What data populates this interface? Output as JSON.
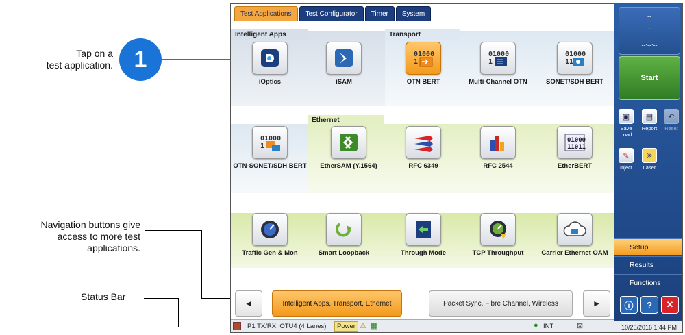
{
  "callouts": {
    "step_number": "1",
    "tap_line1": "Tap on a",
    "tap_line2": "test application.",
    "nav_line1": "Navigation buttons give",
    "nav_line2": "access to more test",
    "nav_line3": "applications.",
    "status_bar": "Status Bar"
  },
  "tabs": [
    "Test Applications",
    "Test Configurator",
    "Timer",
    "System"
  ],
  "groups": {
    "intelligent": "Intelligent Apps",
    "transport": "Transport",
    "ethernet": "Ethernet"
  },
  "apps": [
    {
      "label": "iOptics",
      "icon": "ioptics-icon"
    },
    {
      "label": "iSAM",
      "icon": "isam-icon"
    },
    {
      "label": "OTN BERT",
      "icon": "otn-bert-icon"
    },
    {
      "label": "Multi-Channel OTN",
      "icon": "multi-channel-otn-icon"
    },
    {
      "label": "SONET/SDH BERT",
      "icon": "sonet-sdh-bert-icon"
    },
    {
      "label": "OTN-SONET/SDH BERT",
      "icon": "otn-sonet-sdh-bert-icon"
    },
    {
      "label": "EtherSAM (Y.1564)",
      "icon": "ethersam-icon"
    },
    {
      "label": "RFC 6349",
      "icon": "rfc6349-icon"
    },
    {
      "label": "RFC 2544",
      "icon": "rfc2544-icon"
    },
    {
      "label": "EtherBERT",
      "icon": "etherbert-icon"
    },
    {
      "label": "Traffic Gen & Mon",
      "icon": "traffic-gen-icon"
    },
    {
      "label": "Smart Loopback",
      "icon": "smart-loopback-icon"
    },
    {
      "label": "Through Mode",
      "icon": "through-mode-icon"
    },
    {
      "label": "TCP Throughput",
      "icon": "tcp-throughput-icon"
    },
    {
      "label": "Carrier Ethernet OAM",
      "icon": "carrier-ethernet-oam-icon"
    }
  ],
  "nav": {
    "prev": "◄",
    "page1": "Intelligent Apps, Transport, Ethernet",
    "page2": "Packet Sync, Fibre Channel, Wireless",
    "next": "►"
  },
  "status": {
    "port": "P1 TX/RX: OTU4 (4 Lanes)",
    "power": "Power",
    "clock": "INT",
    "datetime": "10/25/2016 1:44 PM"
  },
  "side": {
    "top_value1": "--",
    "top_value2": "--",
    "timer": "--:--:--",
    "start": "Start",
    "save_load": "Save Load",
    "report": "Report",
    "reset": "Reset",
    "inject": "Inject",
    "laser": "Laser",
    "menu_setup": "Setup",
    "menu_results": "Results",
    "menu_functions": "Functions"
  },
  "colors": {
    "accent": "#f39c22",
    "start": "#3c8a2a",
    "side": "#1f4a8a",
    "callout_line": "#1a73d6"
  }
}
